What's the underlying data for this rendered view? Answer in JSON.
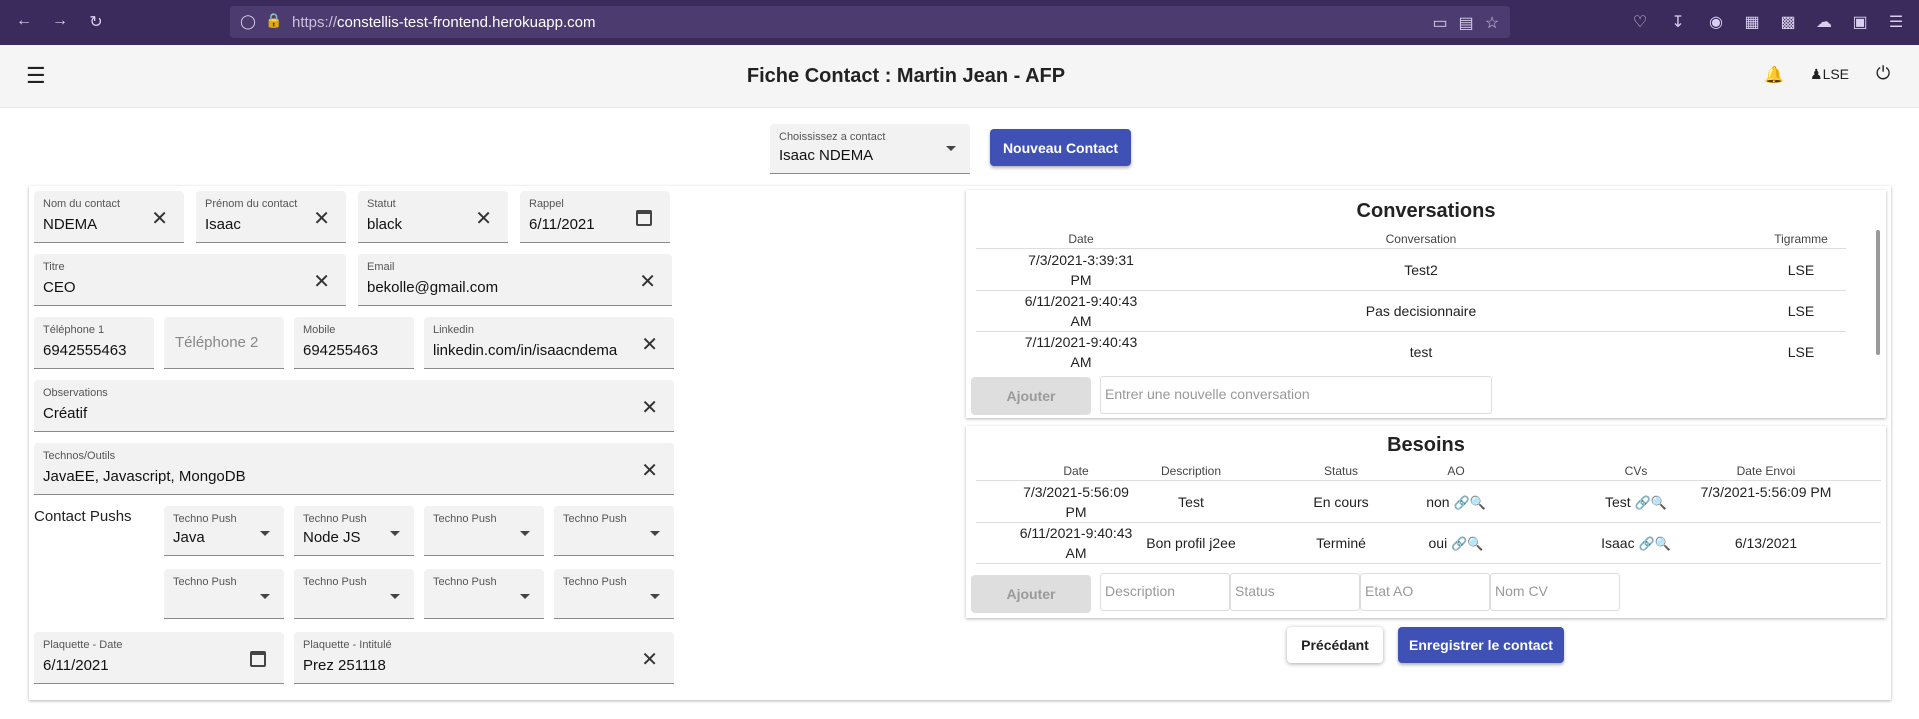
{
  "browser": {
    "url_host": "constellis-test-frontend.herokuapp.com",
    "url_prefix": "https://"
  },
  "header": {
    "title": "Fiche Contact : Martin Jean - AFP",
    "user": "LSE"
  },
  "selector": {
    "label": "Choississez a contact",
    "value": "Isaac NDEMA",
    "new_button": "Nouveau Contact"
  },
  "form": {
    "nom": {
      "label": "Nom du contact",
      "value": "NDEMA"
    },
    "prenom": {
      "label": "Prénom du contact",
      "value": "Isaac"
    },
    "statut": {
      "label": "Statut",
      "value": "black"
    },
    "rappel": {
      "label": "Rappel",
      "value": "6/11/2021"
    },
    "titre": {
      "label": "Titre",
      "value": "CEO"
    },
    "email": {
      "label": "Email",
      "value": "bekolle@gmail.com"
    },
    "tel1": {
      "label": "Téléphone 1",
      "value": "6942555463"
    },
    "tel2": {
      "placeholder": "Téléphone 2"
    },
    "mobile": {
      "label": "Mobile",
      "value": "694255463"
    },
    "linkedin": {
      "label": "Linkedin",
      "value": "linkedin.com/in/isaacndema"
    },
    "observations": {
      "label": "Observations",
      "value": "Créatif"
    },
    "technos": {
      "label": "Technos/Outils",
      "value": "JavaEE, Javascript, MongoDB"
    },
    "pushs_label": "Contact Pushs",
    "pushs": [
      {
        "label": "Techno Push",
        "value": "Java"
      },
      {
        "label": "Techno Push",
        "value": "Node JS"
      },
      {
        "label": "Techno Push",
        "value": ""
      },
      {
        "label": "Techno Push",
        "value": ""
      },
      {
        "label": "Techno Push",
        "value": ""
      },
      {
        "label": "Techno Push",
        "value": ""
      },
      {
        "label": "Techno Push",
        "value": ""
      },
      {
        "label": "Techno Push",
        "value": ""
      }
    ],
    "plaquette_date": {
      "label": "Plaquette - Date",
      "value": "6/11/2021"
    },
    "plaquette_intitule": {
      "label": "Plaquette - Intitulé",
      "value": "Prez 251118"
    }
  },
  "conversations": {
    "title": "Conversations",
    "headers": [
      "Date",
      "Conversation",
      "Tigramme"
    ],
    "rows": [
      {
        "date": "7/3/2021-3:39:31 PM",
        "text": "Test2",
        "tig": "LSE"
      },
      {
        "date": "6/11/2021-9:40:43 AM",
        "text": "Pas decisionnaire",
        "tig": "LSE"
      },
      {
        "date": "7/11/2021-9:40:43 AM",
        "text": "test",
        "tig": "LSE"
      }
    ],
    "add_button": "Ajouter",
    "input_placeholder": "Entrer une nouvelle conversation"
  },
  "besoins": {
    "title": "Besoins",
    "headers": [
      "Date",
      "Description",
      "Status",
      "AO",
      "CVs",
      "Date Envoi"
    ],
    "rows": [
      {
        "date": "7/3/2021-5:56:09 PM",
        "desc": "Test",
        "status": "En cours",
        "ao": "non",
        "cv": "Test",
        "envoi": "7/3/2021-5:56:09 PM"
      },
      {
        "date": "6/11/2021-9:40:43 AM",
        "desc": "Bon profil j2ee",
        "status": "Terminé",
        "ao": "oui",
        "cv": "Isaac",
        "envoi": "6/13/2021"
      }
    ],
    "add_button": "Ajouter",
    "placeholders": [
      "Description",
      "Status",
      "Etat AO",
      "Nom CV"
    ]
  },
  "actions": {
    "prev": "Précédant",
    "save": "Enregistrer le contact"
  },
  "colors": {
    "primary": "#3f51b5",
    "browser": "#3b2a5c"
  }
}
